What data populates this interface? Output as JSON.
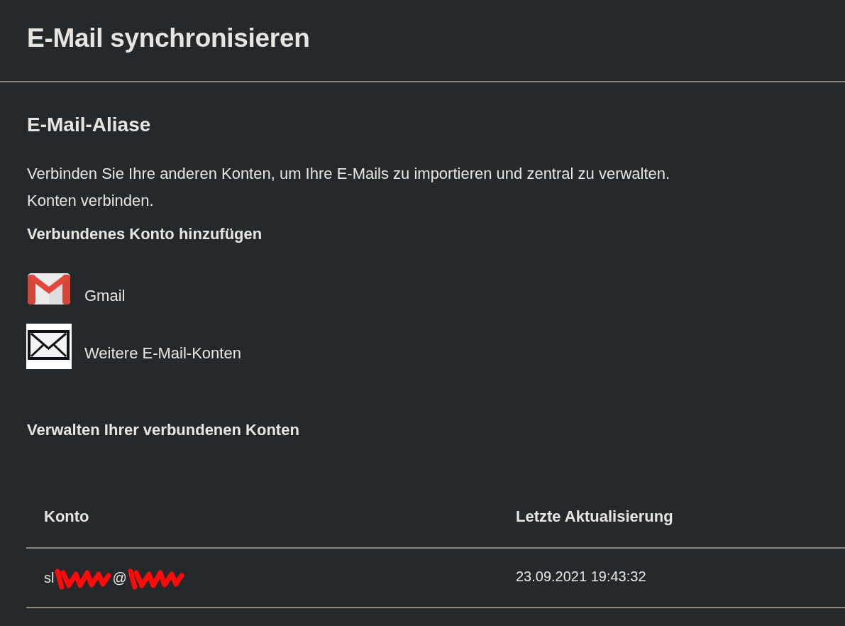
{
  "header": {
    "title": "E-Mail synchronisieren"
  },
  "aliases": {
    "heading": "E-Mail-Aliase",
    "description_lines": [
      "Verbinden Sie Ihre anderen Konten, um Ihre E-Mails zu importieren und zentral zu verwalten.",
      "Konten verbinden."
    ],
    "add_heading": "Verbundenes Konto hinzufügen",
    "providers": [
      {
        "kind": "gmail",
        "label": "Gmail"
      },
      {
        "kind": "other",
        "label": "Weitere E-Mail-Konten"
      }
    ],
    "manage_heading": "Verwalten Ihrer verbundenen Konten",
    "table": {
      "columns": [
        "Konto",
        "Letzte Aktualisierung"
      ],
      "rows": [
        {
          "account": [
            {
              "kind": "text",
              "text": "sl"
            },
            {
              "kind": "redaction"
            },
            {
              "kind": "text",
              "text": "@"
            },
            {
              "kind": "redaction"
            }
          ],
          "last_update": "23.09.2021 19:43:32"
        }
      ]
    }
  }
}
